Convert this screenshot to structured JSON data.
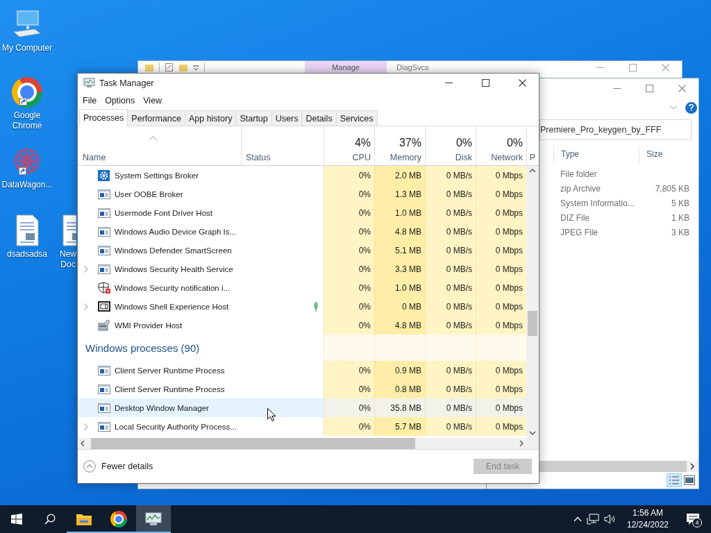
{
  "desktop_icons": [
    {
      "label": "My Computer",
      "kind": "computer"
    },
    {
      "label": "Google Chrome",
      "kind": "chrome"
    },
    {
      "label": "DataWagon...",
      "kind": "datawagon"
    },
    {
      "label": "dsadsadsa",
      "kind": "document"
    },
    {
      "label": "New Doc",
      "kind": "document"
    }
  ],
  "explorer_back": {
    "title": "DiagSvcs",
    "ribbon_tab": "Manage"
  },
  "explorer_front": {
    "address": "Premiere_Pro_keygen_by_FFF",
    "columns": [
      "Type",
      "Size"
    ],
    "rows": [
      {
        "type": "File folder"
      },
      {
        "type": "zip Archive",
        "size": "7,805 KB"
      },
      {
        "type": "System Informatio...",
        "size": "5 KB"
      },
      {
        "type": "DIZ File",
        "size": "1 KB"
      },
      {
        "type": "JPEG File",
        "size": "3 KB"
      }
    ]
  },
  "task_manager": {
    "title": "Task Manager",
    "menu": [
      "File",
      "Options",
      "View"
    ],
    "tabs": [
      {
        "label": "Processes",
        "selected": true
      },
      {
        "label": "Performance",
        "selected": false
      },
      {
        "label": "App history",
        "selected": false
      },
      {
        "label": "Startup",
        "selected": false
      },
      {
        "label": "Users",
        "selected": false
      },
      {
        "label": "Details",
        "selected": false
      },
      {
        "label": "Services",
        "selected": false
      }
    ],
    "columns": [
      {
        "label": "Name"
      },
      {
        "label": "Status"
      },
      {
        "label": "CPU",
        "total": "4%"
      },
      {
        "label": "Memory",
        "total": "37%"
      },
      {
        "label": "Disk",
        "total": "0%"
      },
      {
        "label": "Network",
        "total": "0%"
      },
      {
        "label": "P"
      }
    ],
    "rows": [
      {
        "kind": "process",
        "name": "System Settings Broker",
        "expandable": false,
        "status_leaf": false,
        "hovered": false,
        "cpu": "0%",
        "memory": "2.0 MB",
        "disk": "0 MB/s",
        "network": "0 Mbps"
      },
      {
        "kind": "process",
        "name": "User OOBE Broker",
        "expandable": false,
        "status_leaf": false,
        "hovered": false,
        "cpu": "0%",
        "memory": "1.3 MB",
        "disk": "0 MB/s",
        "network": "0 Mbps"
      },
      {
        "kind": "process",
        "name": "Usermode Font Driver Host",
        "expandable": false,
        "status_leaf": false,
        "hovered": false,
        "cpu": "0%",
        "memory": "1.0 MB",
        "disk": "0 MB/s",
        "network": "0 Mbps"
      },
      {
        "kind": "process",
        "name": "Windows Audio Device Graph Is...",
        "expandable": false,
        "status_leaf": false,
        "hovered": false,
        "cpu": "0%",
        "memory": "4.8 MB",
        "disk": "0 MB/s",
        "network": "0 Mbps"
      },
      {
        "kind": "process",
        "name": "Windows Defender SmartScreen",
        "expandable": false,
        "status_leaf": false,
        "hovered": false,
        "cpu": "0%",
        "memory": "5.1 MB",
        "disk": "0 MB/s",
        "network": "0 Mbps"
      },
      {
        "kind": "process",
        "name": "Windows Security Health Service",
        "expandable": true,
        "status_leaf": false,
        "hovered": false,
        "cpu": "0%",
        "memory": "3.3 MB",
        "disk": "0 MB/s",
        "network": "0 Mbps"
      },
      {
        "kind": "process",
        "name": "Windows Security notification i...",
        "expandable": false,
        "status_leaf": false,
        "hovered": false,
        "cpu": "0%",
        "memory": "1.0 MB",
        "disk": "0 MB/s",
        "network": "0 Mbps"
      },
      {
        "kind": "process",
        "name": "Windows Shell Experience Host",
        "expandable": true,
        "status_leaf": true,
        "hovered": false,
        "cpu": "0%",
        "memory": "0 MB",
        "disk": "0 MB/s",
        "network": "0 Mbps"
      },
      {
        "kind": "process",
        "name": "WMI Provider Host",
        "expandable": false,
        "status_leaf": false,
        "hovered": false,
        "cpu": "0%",
        "memory": "4.8 MB",
        "disk": "0 MB/s",
        "network": "0 Mbps"
      },
      {
        "kind": "group",
        "label": "Windows processes (90)"
      },
      {
        "kind": "process",
        "name": "Client Server Runtime Process",
        "expandable": false,
        "status_leaf": false,
        "hovered": false,
        "cpu": "0%",
        "memory": "0.9 MB",
        "disk": "0 MB/s",
        "network": "0 Mbps"
      },
      {
        "kind": "process",
        "name": "Client Server Runtime Process",
        "expandable": false,
        "status_leaf": false,
        "hovered": false,
        "cpu": "0%",
        "memory": "0.8 MB",
        "disk": "0 MB/s",
        "network": "0 Mbps"
      },
      {
        "kind": "process",
        "name": "Desktop Window Manager",
        "expandable": false,
        "status_leaf": false,
        "hovered": true,
        "cpu": "0%",
        "memory": "35.8 MB",
        "disk": "0 MB/s",
        "network": "0 Mbps"
      },
      {
        "kind": "process",
        "name": "Local Security Authority Process...",
        "expandable": true,
        "status_leaf": false,
        "hovered": false,
        "cpu": "0%",
        "memory": "5.7 MB",
        "disk": "0 MB/s",
        "network": "0 Mbps"
      }
    ],
    "footer_link": "Fewer details",
    "end_task": {
      "label": "End task",
      "disabled": true
    }
  },
  "taskbar": {
    "apps": [
      {
        "kind": "file-explorer",
        "active": false
      },
      {
        "kind": "chrome",
        "active": false
      },
      {
        "kind": "task-manager",
        "active": true
      }
    ],
    "time": "1:56 AM",
    "date": "12/24/2022",
    "notification_count": "4"
  }
}
